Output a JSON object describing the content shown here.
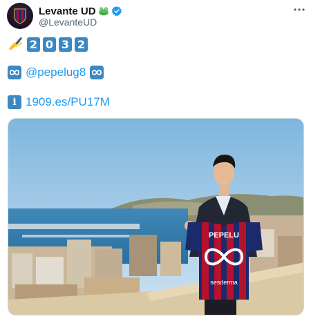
{
  "account": {
    "display_name": "Levante UD",
    "handle": "@LevanteUD",
    "badge_emoji": "frog",
    "verified_color": "#1d9bf0"
  },
  "tweet": {
    "line1": {
      "emoji": "writing-hand",
      "digits": [
        "2",
        "0",
        "3",
        "2"
      ]
    },
    "line2": {
      "mention": "@pepelug8",
      "icon": "infinity-badge"
    },
    "line3": {
      "icon": "information-badge",
      "link": "1909.es/PU17M"
    }
  },
  "media": {
    "shirt_name": "PEPELU",
    "shirt_sponsor": "sesderma",
    "shirt_colors": [
      "#b5122e",
      "#1b2a6b"
    ]
  },
  "colors": {
    "accent": "#1d9bf0",
    "keycap": "#3b88c3",
    "text": "#0f1419",
    "muted": "#536471"
  }
}
